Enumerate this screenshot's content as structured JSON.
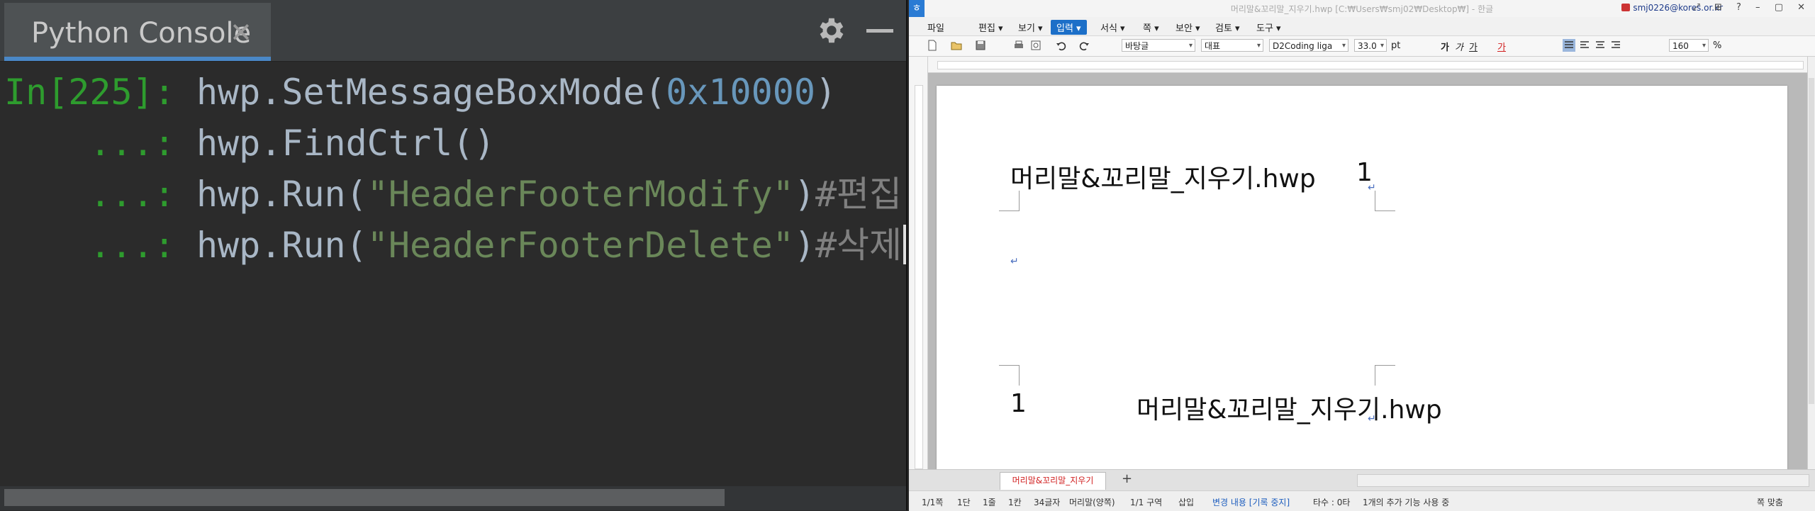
{
  "console": {
    "tab_title": "Python Console",
    "tab_close": "✕",
    "lines": [
      {
        "prompt": "In[225]: ",
        "code": "hwp.SetMessageBoxMode(",
        "str": "",
        "num": "0x10000",
        "tail": ")",
        "comment": ""
      },
      {
        "prompt": "    ...: ",
        "code": "hwp.FindCtrl()",
        "str": "",
        "num": "",
        "tail": "",
        "comment": ""
      },
      {
        "prompt": "    ...: ",
        "code": "hwp.Run(",
        "str": "\"HeaderFooterModify\"",
        "num": "",
        "tail": ")",
        "comment": "#편집"
      },
      {
        "prompt": "    ...: ",
        "code": "hwp.Run(",
        "str": "\"HeaderFooterDelete\"",
        "num": "",
        "tail": ")",
        "comment": "#삭제"
      }
    ]
  },
  "hwp": {
    "window_title": "머리말&꼬리말_지우기.hwp [C:₩Users₩smj02₩Desktop₩] - 한글",
    "account": "smj0226@kores.or.kr",
    "window_buttons": "⤢ ⊞ ? – ▢ ✕",
    "menus": [
      "파일",
      "편집 ▾",
      "보기 ▾",
      "입력 ▾",
      "서식 ▾",
      "쪽 ▾",
      "보안 ▾",
      "검토 ▾",
      "도구 ▾"
    ],
    "active_menu_index": 3,
    "toolbar": {
      "style": "바탕글",
      "font_lang": "대표",
      "font_name": "D2Coding liga",
      "font_size": "33.0",
      "font_unit": "pt",
      "zoom": "160",
      "zoom_unit": "%"
    },
    "page": {
      "header_text": "머리말&꼬리말_지우기.hwp",
      "header_page": "1",
      "footer_page": "1",
      "footer_text": "머리말&꼬리말_지우기.hwp",
      "para_mark": "↵"
    },
    "doc_tab": "머리말&꼬리말_지우기",
    "add_tab": "+",
    "status": {
      "page": "1/1쪽",
      "section_col": "1단",
      "line": "1줄",
      "col": "1칸",
      "chars": "34글자",
      "area": "머리말(양쪽)",
      "section": "1/1 구역",
      "mode": "삽입",
      "track": "변경 내용 [기록 중지]",
      "typo": "타수 : 0타",
      "extra": "1개의 추가 기능 사용 중",
      "fit": "쪽 맞춤"
    }
  }
}
